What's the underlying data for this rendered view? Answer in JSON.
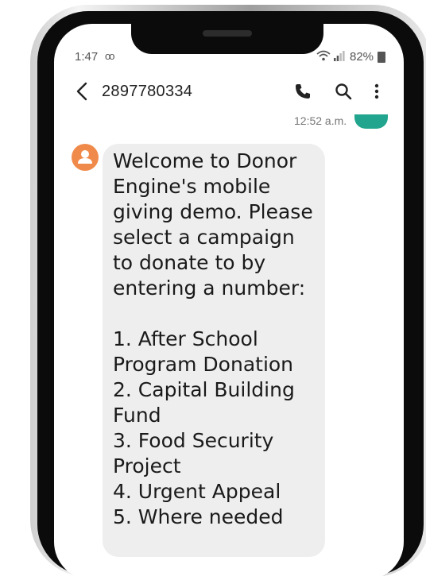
{
  "status_bar": {
    "time": "1:47",
    "voicemail_icon": "voicemail-icon",
    "wifi_icon": "wifi-icon",
    "signal_icon": "signal-icon",
    "battery": "82%"
  },
  "header": {
    "contact_number": "2897780334",
    "back_icon": "arrow-left",
    "call_icon": "phone",
    "search_icon": "magnifier",
    "menu_icon": "three-dot-vertical"
  },
  "messages": {
    "sent_timestamp": "12:52 a.m.",
    "received": {
      "text": "Welcome to Donor\nEngine's mobile\ngiving demo. Please\nselect a campaign\nto donate to by\nentering a number:\n\n1. After School\nProgram Donation\n2. Capital Building\nFund\n3. Food Security\nProject\n4. Urgent Appeal\n5. Where needed"
    }
  },
  "colors": {
    "avatar": "#f08a4b",
    "sent_bubble": "#22a58e",
    "received_bubble": "#eeeeee"
  }
}
